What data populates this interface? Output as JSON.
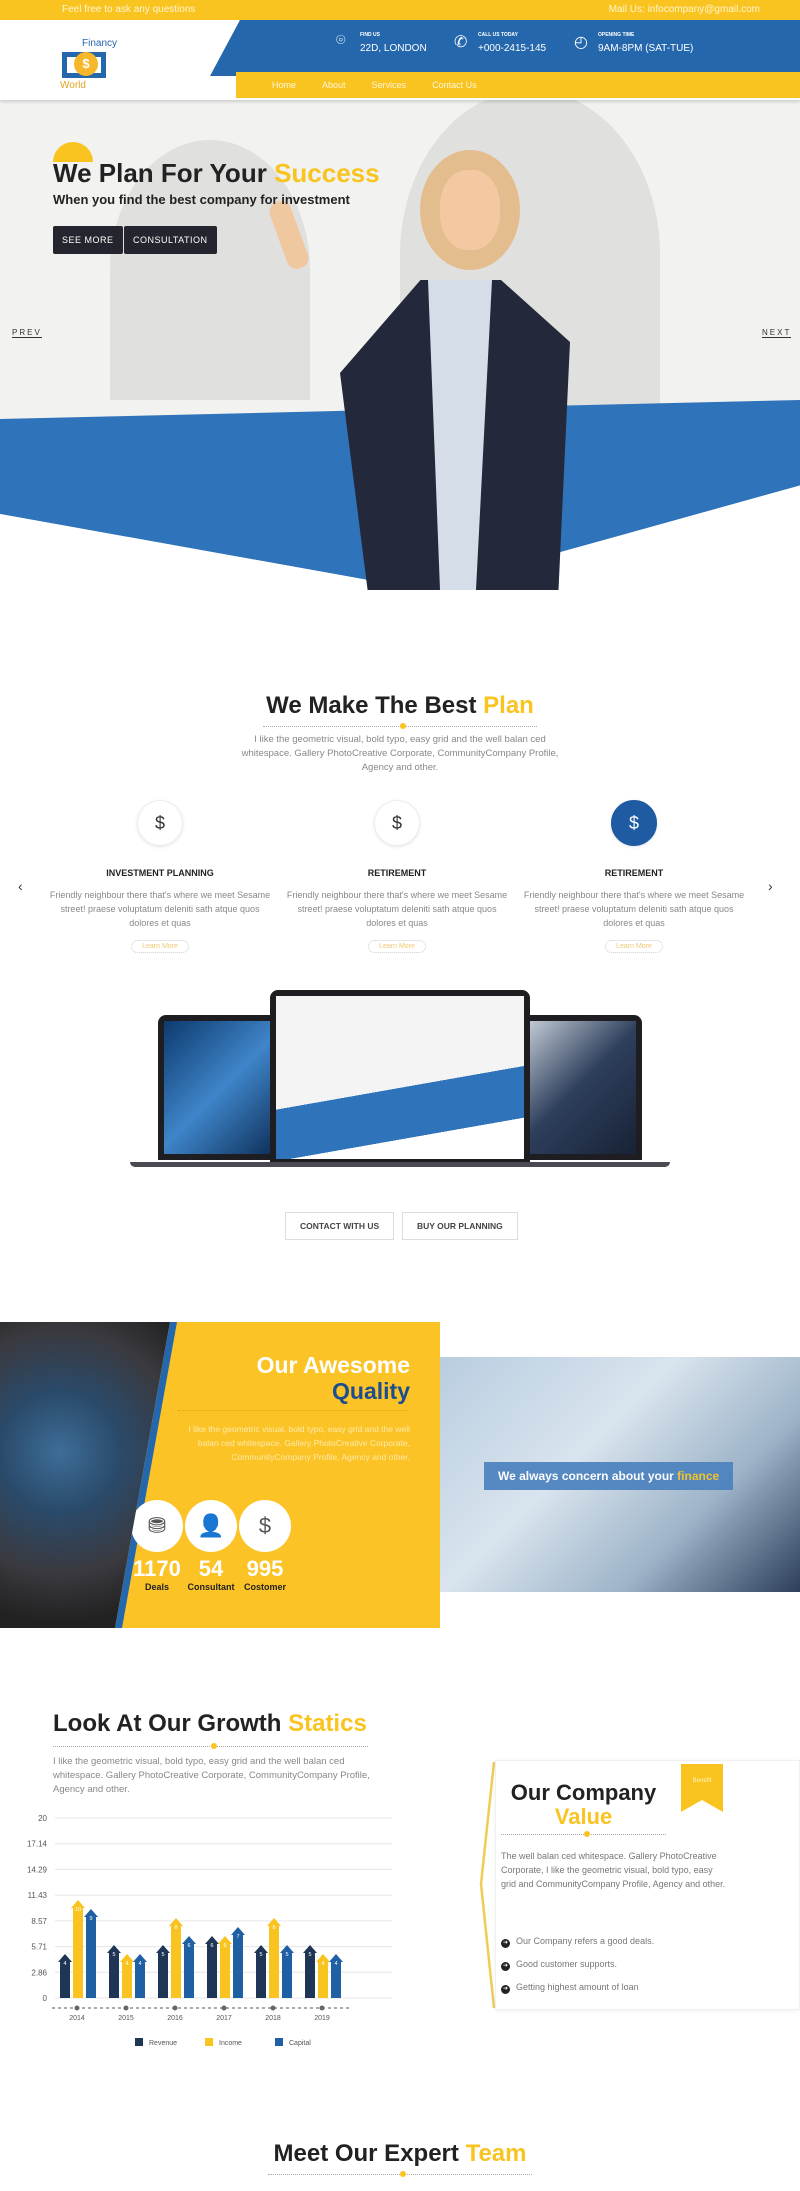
{
  "topbar": {
    "left_text": "Feel free to ask any questions",
    "right_text": "Mail Us: infocompany@gmail.com"
  },
  "logo": {
    "word1": "Financy",
    "word2": "World",
    "symbol": "$"
  },
  "header": {
    "info": [
      {
        "label": "FIND US",
        "value": "22D, LONDON",
        "icon": "location-pin-icon"
      },
      {
        "label": "CALL US TODAY",
        "value": "+000-2415-145",
        "icon": "phone-icon"
      },
      {
        "label": "OPENING TIME",
        "value": "9AM-8PM (SAT-TUE)",
        "icon": "clock-icon"
      }
    ],
    "nav": [
      "Home",
      "About",
      "Services",
      "Contact Us"
    ]
  },
  "hero": {
    "title": "We Plan For Your",
    "title_accent": "Success",
    "subtitle": "When you find the best company for investment",
    "buttons": [
      "SEE MORE",
      "CONSULTATION"
    ],
    "prev": "PREV",
    "next": "NEXT"
  },
  "plan": {
    "title": "We Make The Best",
    "title_accent": "Plan",
    "desc": "I like the geometric visual, bold typo, easy grid and the well balan ced whitespace. Gallery PhotoCreative Corporate, CommunityCompany Profile, Agency and other.",
    "cards": [
      {
        "title": "INVESTMENT PLANNING",
        "text": "Friendly neighbour there that's where we meet Sesame street! praese voluptatum deleniti sath atque quos dolores et quas",
        "link": "Learn More"
      },
      {
        "title": "RETIREMENT",
        "text": "Friendly neighbour there that's where we meet Sesame street! praese voluptatum deleniti sath atque quos dolores et quas",
        "link": "Learn More"
      },
      {
        "title": "RETIREMENT",
        "text": "Friendly neighbour there that's where we meet Sesame street! praese voluptatum deleniti sath atque quos dolores et quas",
        "link": "Learn More"
      }
    ],
    "buttons": [
      "CONTACT WITH US",
      "BUY OUR PLANNING"
    ]
  },
  "quality": {
    "title": "Our Awesome",
    "title_accent": "Quality",
    "desc": "I like the geometric visual, bold typo, easy grid and the well balan ced whitespace. Gallery PhotoCreative Corporate, CommunityCompany Profile, Agency and other.",
    "stats": [
      {
        "value": "1170",
        "label": "Deals"
      },
      {
        "value": "54",
        "label": "Consultant"
      },
      {
        "value": "995",
        "label": "Costomer"
      }
    ],
    "banner": "We always concern about your",
    "banner_accent": "finance"
  },
  "growth": {
    "title": "Look At Our Growth",
    "title_accent": "Statics",
    "desc": "I like the geometric visual, bold typo, easy grid and the well balan ced whitespace. Gallery PhotoCreative Corporate, CommunityCompany Profile, Agency and other."
  },
  "chart_data": {
    "type": "bar",
    "categories": [
      "2014",
      "2015",
      "2016",
      "2017",
      "2018",
      "2019"
    ],
    "yticks": [
      "0",
      "2.86",
      "5.71",
      "8.57",
      "11.43",
      "14.29",
      "17.14",
      "20"
    ],
    "ylim": [
      0,
      20
    ],
    "grid": true,
    "legend": "bottom",
    "series": [
      {
        "name": "Revenue",
        "color": "#1e3556",
        "values": [
          4,
          5,
          5,
          6,
          5,
          5
        ]
      },
      {
        "name": "Income",
        "color": "#f9c320",
        "values": [
          10,
          4,
          8,
          6,
          8,
          4
        ]
      },
      {
        "name": "Capital",
        "color": "#1f5fa4",
        "values": [
          9,
          4,
          6,
          7,
          5,
          4
        ]
      }
    ]
  },
  "value": {
    "title": "Our Company",
    "title_accent": "Value",
    "badge": "Benefit",
    "desc": "The well balan ced whitespace. Gallery PhotoCreative Corporate, I like the geometric visual, bold typo, easy grid and CommunityCompany Profile, Agency and other.",
    "items": [
      "Our Company refers a good deals.",
      "Good customer supports.",
      "Getting highest amount of loan"
    ]
  },
  "team": {
    "title": "Meet Our Expert",
    "title_accent": "Team"
  }
}
